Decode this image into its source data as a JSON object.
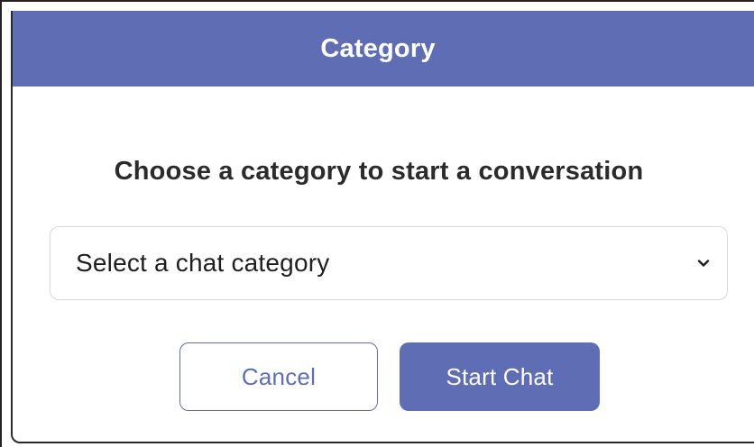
{
  "dialog": {
    "title": "Category",
    "prompt": "Choose a category to start a conversation"
  },
  "category_select": {
    "selected_value": "Select a chat category",
    "icon": "chevron-down-icon"
  },
  "buttons": {
    "cancel_label": "Cancel",
    "start_label": "Start Chat"
  },
  "colors": {
    "accent": "#5f6db5",
    "header_text": "#ffffff",
    "body_text": "#2b2b2b"
  }
}
